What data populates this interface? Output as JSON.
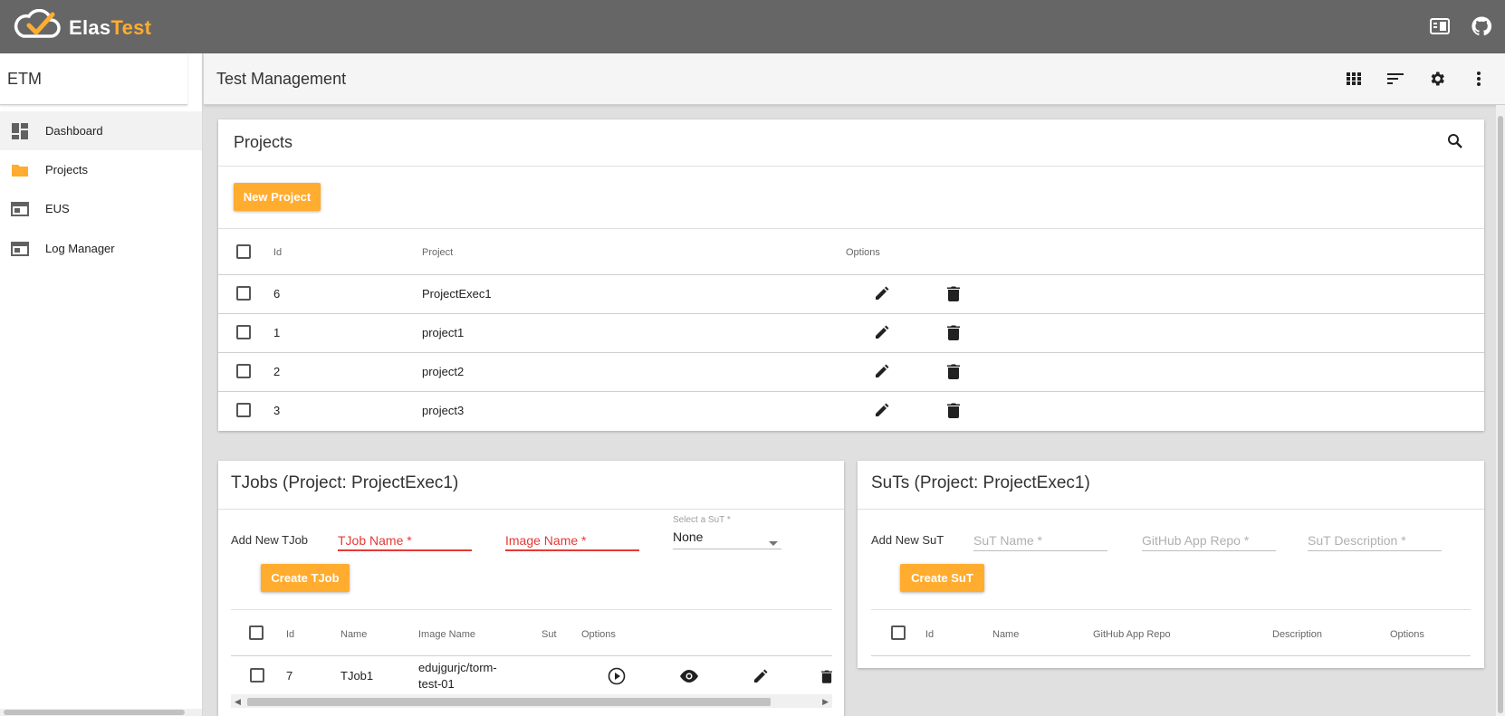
{
  "app": {
    "name_part1": "Elas",
    "name_part2": "Test",
    "brand_color": "#ffac2f",
    "header_color": "#666666"
  },
  "header": {
    "icons": [
      "dashboard-panel-icon",
      "github-icon"
    ]
  },
  "sidebar": {
    "title": "ETM",
    "items": [
      {
        "label": "Dashboard",
        "icon": "dashboard-icon",
        "active": true
      },
      {
        "label": "Projects",
        "icon": "folder-icon",
        "active": false
      },
      {
        "label": "EUS",
        "icon": "web-window-icon",
        "active": false
      },
      {
        "label": "Log Manager",
        "icon": "web-window-icon",
        "active": false
      }
    ]
  },
  "toolbar": {
    "title": "Test Management",
    "icons": [
      "grid-view-icon",
      "sort-icon",
      "settings-icon",
      "more-vert-icon"
    ]
  },
  "projects": {
    "title": "Projects",
    "new_button": "New Project",
    "columns": {
      "id": "Id",
      "project": "Project",
      "options": "Options"
    },
    "rows": [
      {
        "id": "6",
        "name": "ProjectExec1"
      },
      {
        "id": "1",
        "name": "project1"
      },
      {
        "id": "2",
        "name": "project2"
      },
      {
        "id": "3",
        "name": "project3"
      }
    ]
  },
  "tjobs": {
    "title": "TJobs (Project: ProjectExec1)",
    "add_label": "Add New TJob",
    "tjob_name_placeholder": "TJob Name *",
    "image_name_placeholder": "Image Name *",
    "sut_select_label": "Select a SuT *",
    "sut_select_value": "None",
    "create_button": "Create TJob",
    "columns": {
      "id": "Id",
      "name": "Name",
      "image": "Image Name",
      "sut": "Sut",
      "options": "Options"
    },
    "rows": [
      {
        "id": "7",
        "name": "TJob1",
        "image_line1": "edujgurjc/torm-",
        "image_line2": "test-01",
        "sut": ""
      }
    ]
  },
  "suts": {
    "title": "SuTs (Project: ProjectExec1)",
    "add_label": "Add New SuT",
    "sut_name_placeholder": "SuT Name *",
    "repo_placeholder": "GitHub App Repo *",
    "desc_placeholder": "SuT Description *",
    "create_button": "Create SuT",
    "columns": {
      "id": "Id",
      "name": "Name",
      "repo": "GitHub App Repo",
      "description": "Description",
      "options": "Options"
    }
  }
}
